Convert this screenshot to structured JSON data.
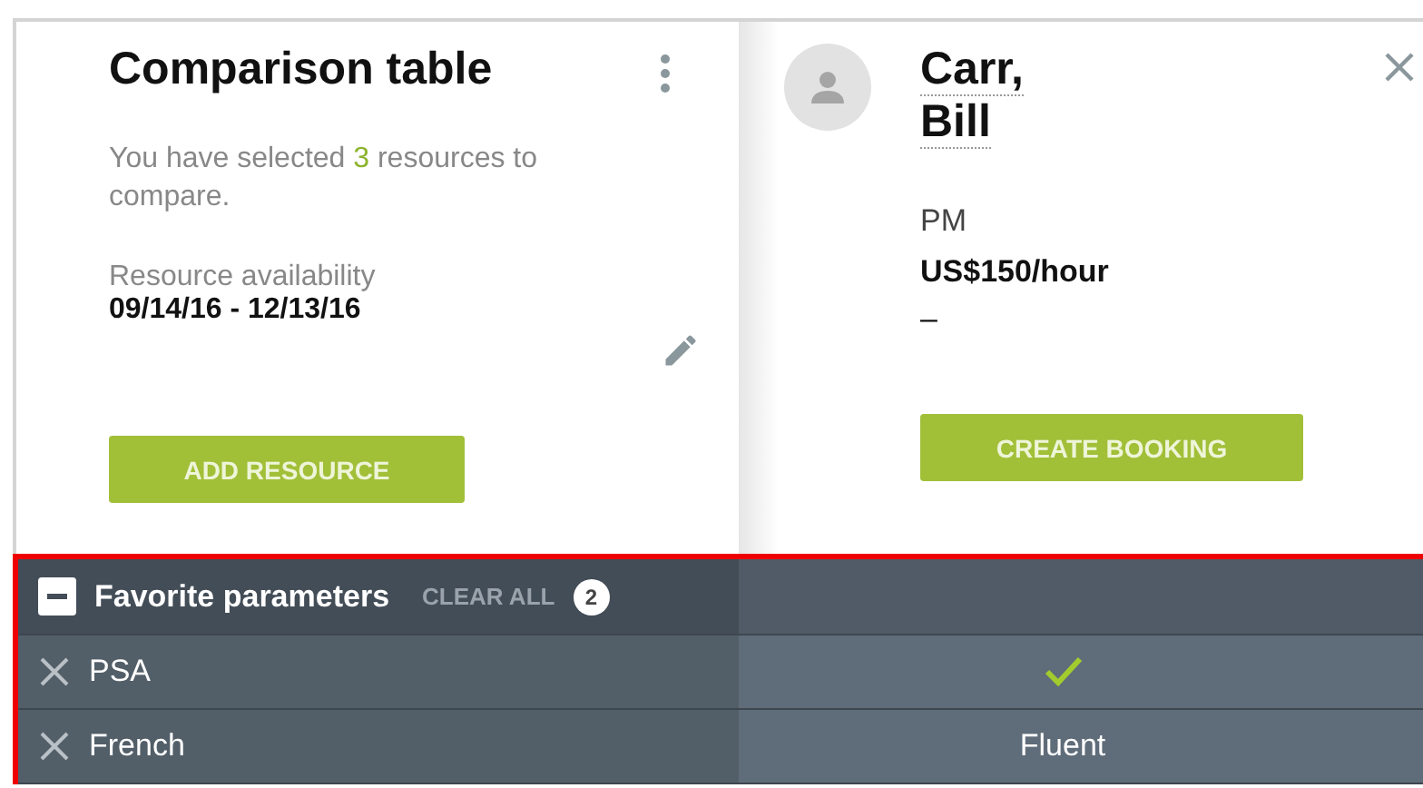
{
  "summary": {
    "title": "Comparison table",
    "selected_text": "You have selected **3** resources to compare.",
    "availability_label": "Resource availability",
    "availability_range": "09/14/16 - 12/13/16",
    "add_button": "ADD RESOURCE"
  },
  "resource": {
    "last_name": "Carr,",
    "first_name": "Bill",
    "role": "PM",
    "rate": "US$150/hour",
    "extra": "–",
    "booking_button": "CREATE BOOKING"
  },
  "favorites": {
    "title": "Favorite parameters",
    "expanded": true,
    "clear_label": "CLEAR ALL",
    "count": "2",
    "rows": [
      {
        "name": "PSA",
        "kind": "check"
      },
      {
        "name": "French",
        "kind": "text",
        "value": "Fluent"
      }
    ]
  }
}
